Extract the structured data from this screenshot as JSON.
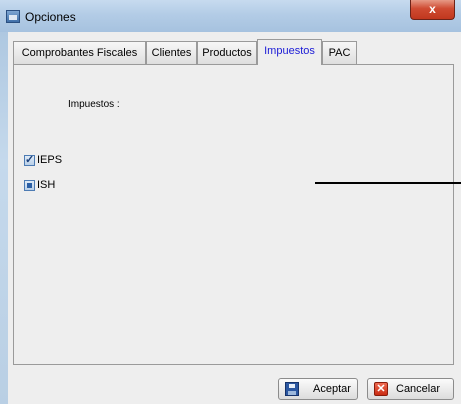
{
  "window": {
    "title": "Opciones",
    "close_label": "x"
  },
  "tabs": [
    {
      "label": "Comprobantes Fiscales",
      "active": false
    },
    {
      "label": "Clientes",
      "active": false
    },
    {
      "label": "Productos",
      "active": false
    },
    {
      "label": "Impuestos",
      "active": true
    },
    {
      "label": "PAC",
      "active": false
    }
  ],
  "impuestos": {
    "section_label": "Impuestos :",
    "options": [
      {
        "label": "IEPS",
        "state": "checked"
      },
      {
        "label": "ISH",
        "state": "indeterminate"
      }
    ]
  },
  "buttons": {
    "accept_label": "Aceptar",
    "cancel_label": "Cancelar"
  },
  "colors": {
    "active_tab_text": "#1b1bd6",
    "close_button": "#c1371e"
  }
}
